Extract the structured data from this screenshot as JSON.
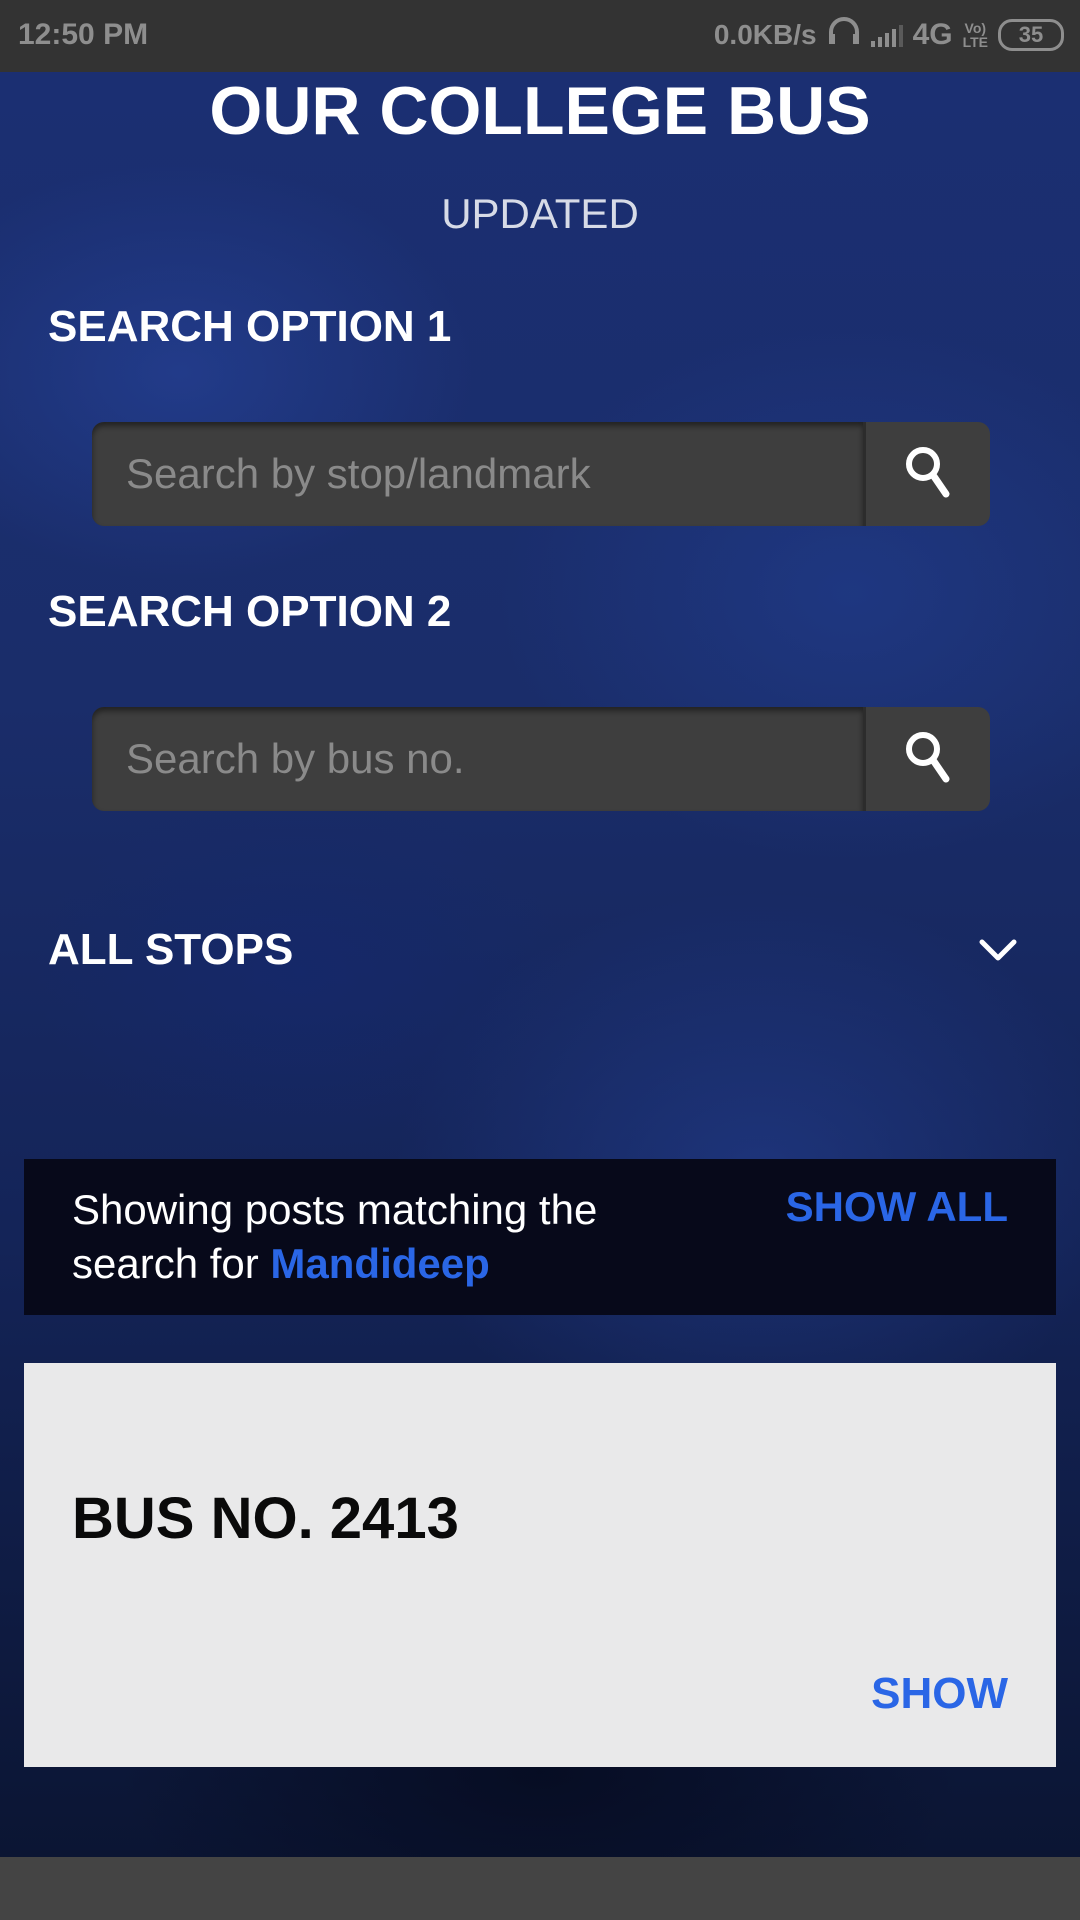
{
  "status_bar": {
    "time": "12:50 PM",
    "net_speed": "0.0KB/s",
    "network": "4G",
    "volte": "Vo)\nLTE",
    "battery": "35"
  },
  "header": {
    "title": "OUR COLLEGE BUS",
    "subtitle": "UPDATED"
  },
  "search1": {
    "label": "SEARCH OPTION 1",
    "placeholder": "Search by stop/landmark"
  },
  "search2": {
    "label": "SEARCH OPTION 2",
    "placeholder": "Search by bus no."
  },
  "all_stops": {
    "label": "ALL STOPS"
  },
  "filter": {
    "text": "Showing posts matching the search for ",
    "query": "Mandideep",
    "show_all": "SHOW ALL"
  },
  "result": {
    "title": "BUS NO. 2413",
    "action": "SHOW"
  },
  "colors": {
    "accent": "#2a66e6",
    "background": "#1a2d6a",
    "card": "#e9e9ea"
  }
}
